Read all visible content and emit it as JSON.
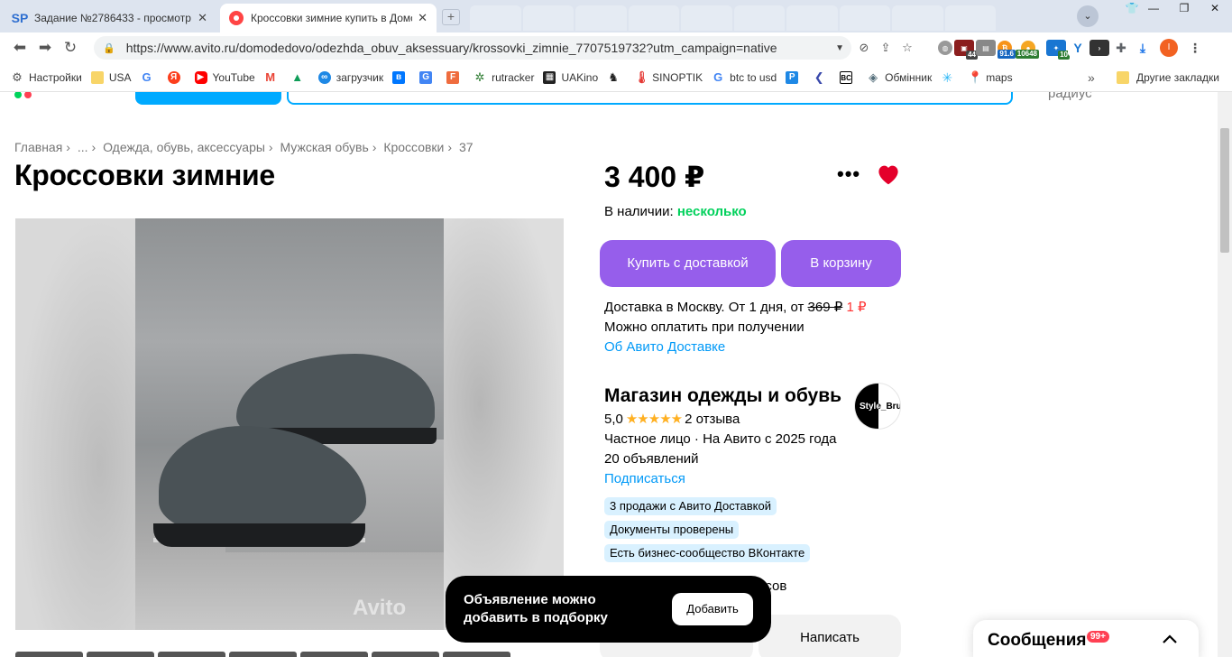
{
  "browser": {
    "tabs": [
      {
        "title": "Задание №2786433 - просмотр з",
        "favicon": "SP"
      },
      {
        "title": "Кроссовки зимние купить в Домс",
        "favicon": "avito-icon"
      }
    ],
    "url": "https://www.avito.ru/domodedovo/odezhda_obuv_aksessuary/krossovki_zimnie_7707519732?utm_campaign=native",
    "extensions": {
      "badge_a": "44",
      "badge_b": "91.6",
      "badge_c": "10648",
      "badge_d": "10",
      "profile_letter": "I"
    },
    "bookmarks": [
      "Настройки",
      "USA",
      "YouTube",
      "загрузчик",
      "rutracker",
      "UAKino",
      "SINOPTIK",
      "btc to usd",
      "Обмінник",
      "maps"
    ],
    "bookmarks_more": "»",
    "other_bookmarks": "Другие закладки"
  },
  "header": {
    "radius_text": "радиус"
  },
  "breadcrumb": [
    "Главная",
    "...",
    "Одежда, обувь, аксессуары",
    "Мужская обувь",
    "Кроссовки",
    "37"
  ],
  "listing": {
    "title": "Кроссовки зимние",
    "price": "3 400 ₽",
    "availability_label": "В наличии:",
    "availability_value": "несколько",
    "buy_button": "Купить с доставкой",
    "cart_button": "В корзину",
    "delivery_prefix": "Доставка в Москву. От 1 дня, от",
    "delivery_old_price": "369 ₽",
    "delivery_new_price": "1 ₽",
    "payment_note": "Можно оплатить при получении",
    "delivery_link": "Об Авито Доставке",
    "watermark": "Avito"
  },
  "seller": {
    "name": "Магазин одежды и обувь",
    "logo_text": "Style_Bru",
    "rating": "5,0",
    "stars": "★★★★★",
    "reviews": "2 отзыва",
    "type": "Частное лицо · На Авито с 2025 года",
    "ads_count": "20 объявлений",
    "subscribe": "Подписаться",
    "chips": [
      "3 продажи с Авито Доставкой",
      "Документы проверены",
      "Есть бизнес-сообщество ВКонтакте"
    ],
    "partial_text": "асов"
  },
  "actions": {
    "write_button": "Написать"
  },
  "toast": {
    "message": "Объявление можно добавить в подборку",
    "button": "Добавить"
  },
  "messages": {
    "label": "Сообщения",
    "count": "99+"
  },
  "colors": {
    "accent_purple": "#965eeb",
    "link_blue": "#0099f7",
    "available_green": "#02d15c",
    "heart_red": "#e4002b",
    "chip_bg": "#d9f1ff"
  }
}
